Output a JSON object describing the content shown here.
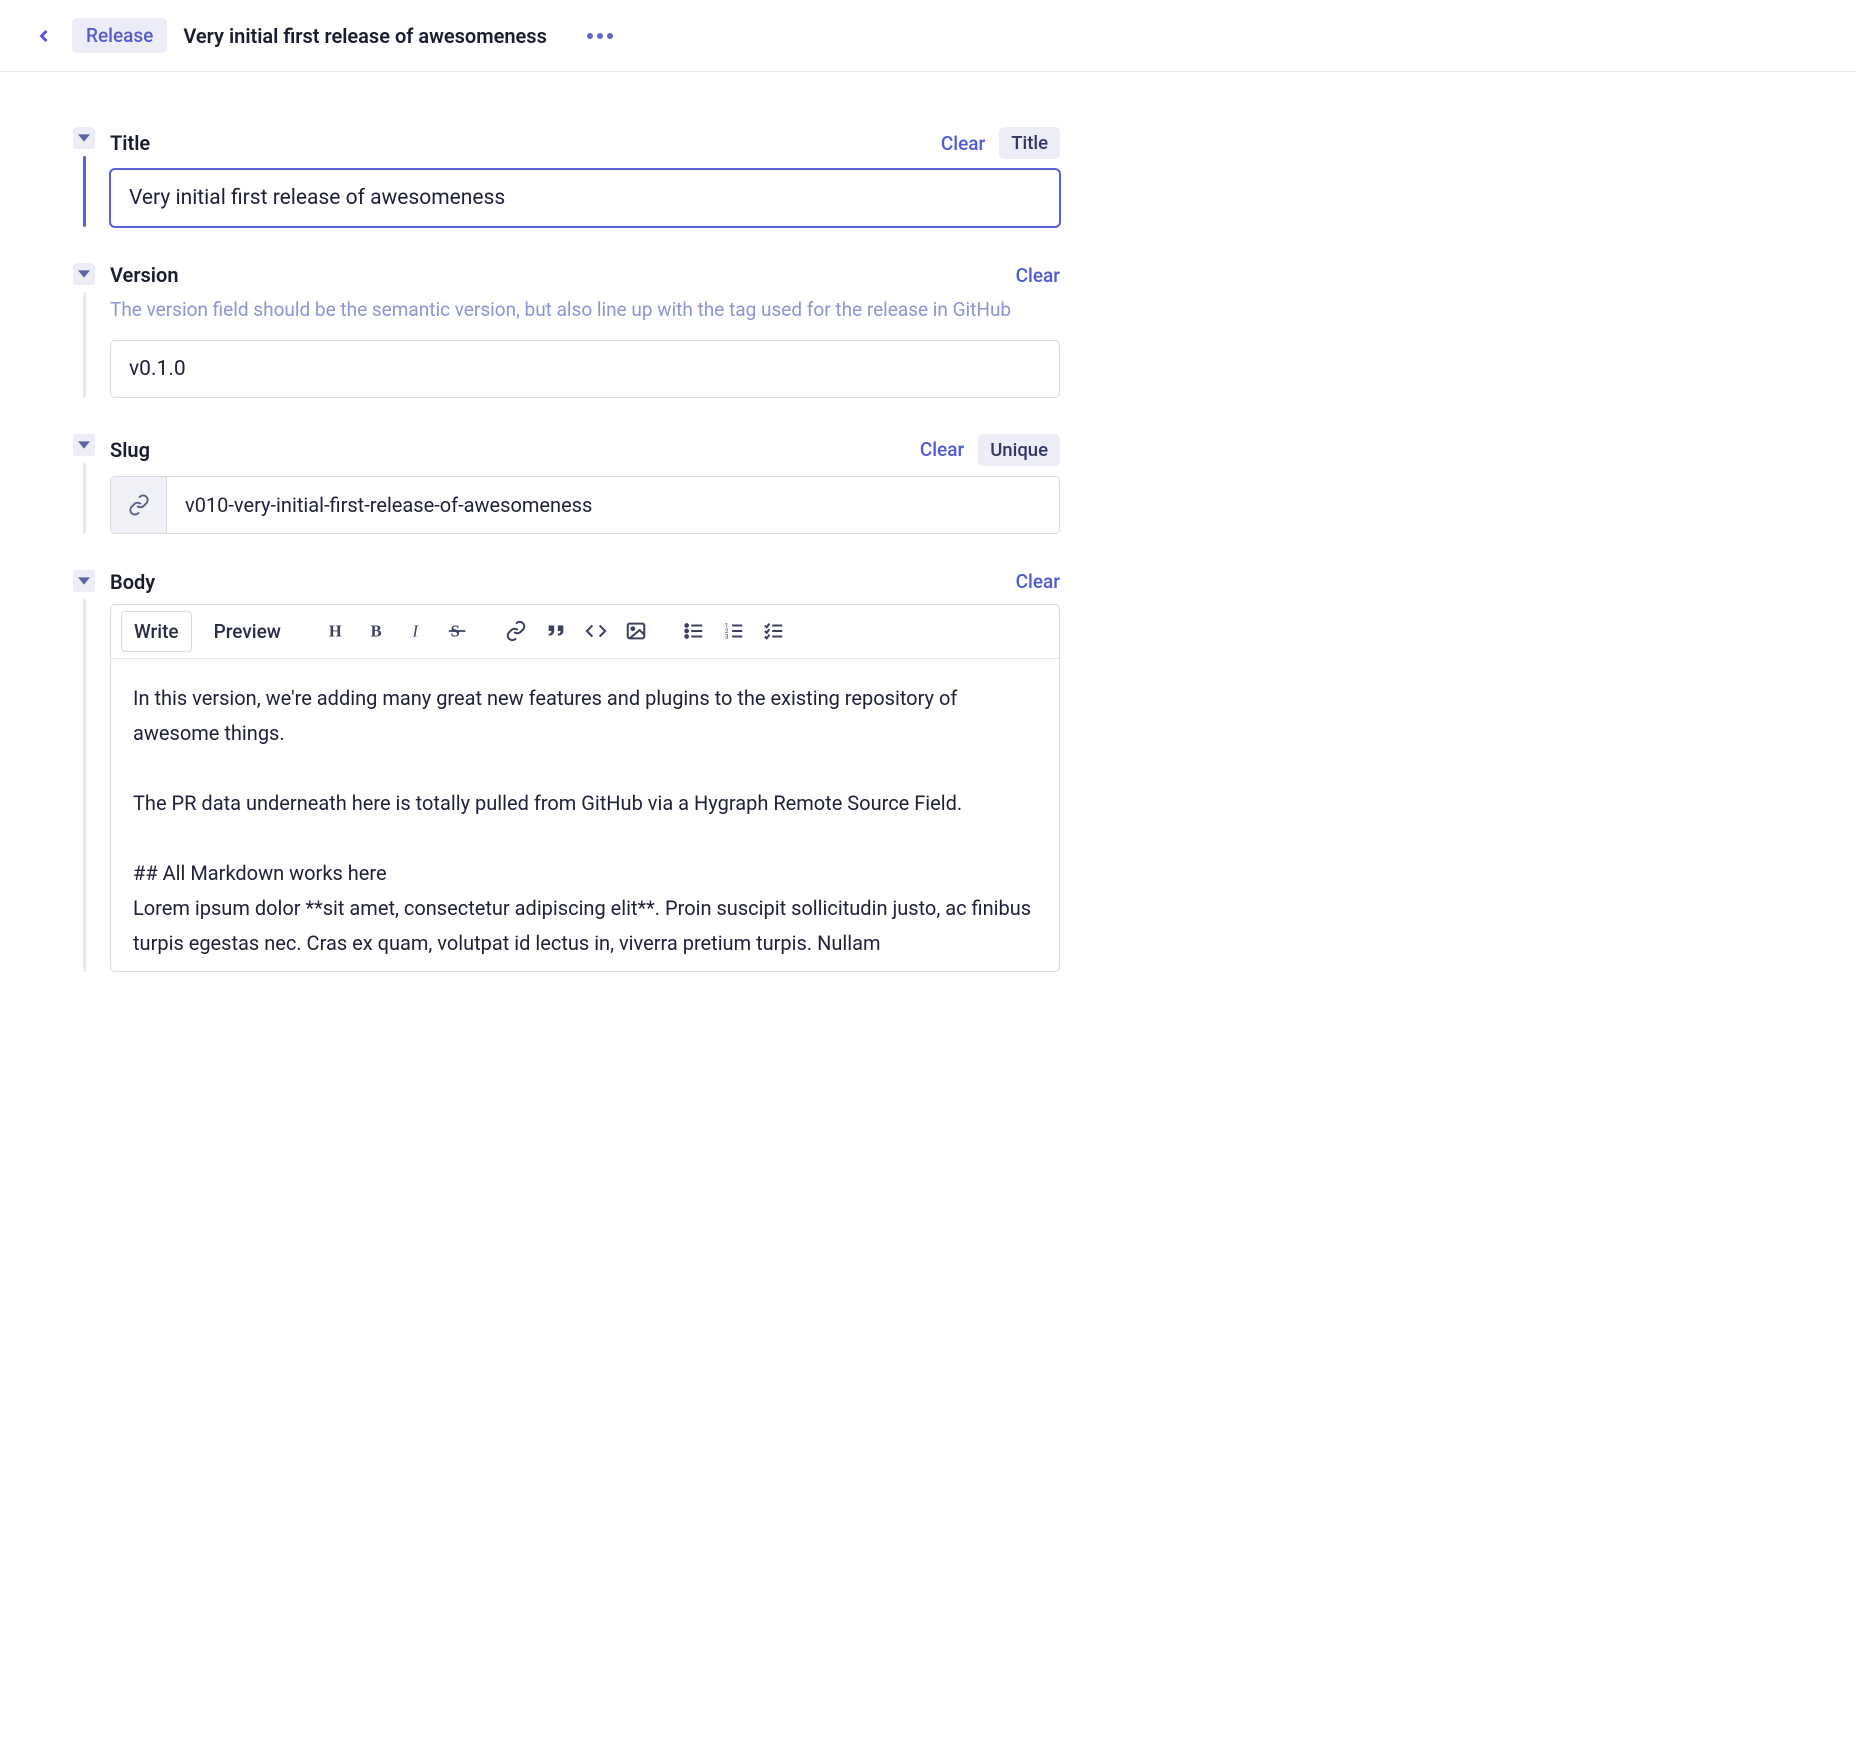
{
  "header": {
    "tag": "Release",
    "title": "Very initial first release of awesomeness"
  },
  "fields": {
    "title": {
      "label": "Title",
      "value": "Very initial first release of awesomeness",
      "clear": "Clear",
      "badge": "Title"
    },
    "version": {
      "label": "Version",
      "clear": "Clear",
      "description": "The version field should be the semantic version, but also line up with the tag used for the release in GitHub",
      "value": "v0.1.0"
    },
    "slug": {
      "label": "Slug",
      "clear": "Clear",
      "badge": "Unique",
      "value": "v010-very-initial-first-release-of-awesomeness"
    },
    "body": {
      "label": "Body",
      "clear": "Clear",
      "tabs": {
        "write": "Write",
        "preview": "Preview"
      },
      "content": "In this version, we're adding many great new features and plugins to the existing repository of awesome things.\n\nThe PR data underneath here is totally pulled from GitHub via a Hygraph Remote Source Field.\n\n## All Markdown works here\nLorem ipsum dolor **sit amet, consectetur adipiscing elit**. Proin suscipit sollicitudin justo, ac finibus turpis egestas nec. Cras ex quam, volutpat id lectus in, viverra pretium turpis. Nullam"
    }
  }
}
